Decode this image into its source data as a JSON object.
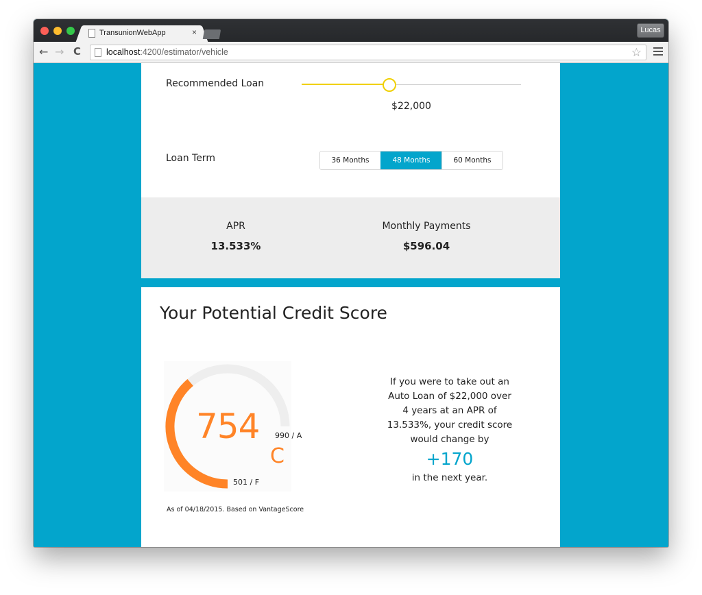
{
  "browser": {
    "tab_title": "TransunionWebApp",
    "tab_close": "×",
    "profile": "Lucas",
    "url_host": "localhost",
    "url_path": ":4200/estimator/vehicle"
  },
  "loan": {
    "recommended_label": "Recommended Loan",
    "slider_fraction": 0.4,
    "amount": "$22,000",
    "term_label": "Loan Term",
    "terms": [
      "36 Months",
      "48 Months",
      "60 Months"
    ],
    "selected_term": "48 Months"
  },
  "summary": {
    "apr_label": "APR",
    "apr_value": "13.533%",
    "payments_label": "Monthly Payments",
    "payments_value": "$596.04"
  },
  "credit": {
    "title": "Your Potential Credit Score",
    "score": "754",
    "score_value": 754,
    "min_score": 501,
    "max_score": 990,
    "grade": "C",
    "max_label": "990 / A",
    "min_label": "501 / F",
    "as_of": "As of 04/18/2015. Based on VantageScore",
    "explain_lines": [
      "If you were to take out an",
      "Auto Loan of $22,000 over",
      "4 years at an APR of",
      "13.533%, your credit score",
      "would change by"
    ],
    "delta": "+170",
    "explain_tail": "in the next year."
  },
  "colors": {
    "accent": "#03a5cc",
    "slider": "#f0d000",
    "score": "#ff8427",
    "gauge_track": "#eeeeee"
  }
}
